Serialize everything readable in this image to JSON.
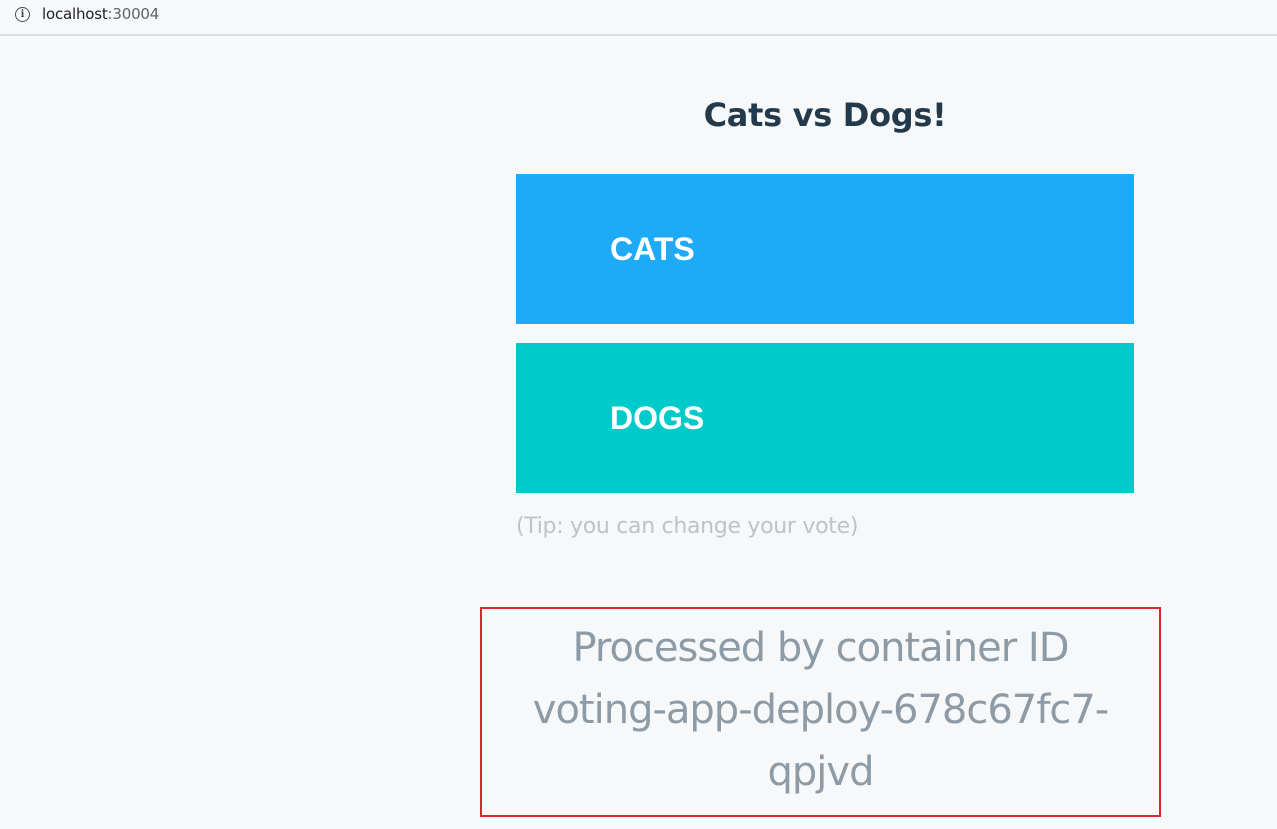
{
  "browser": {
    "url_host": "localhost",
    "url_port": ":30004",
    "info_icon": "info-circle-icon"
  },
  "page": {
    "title": "Cats vs Dogs!",
    "options": [
      {
        "label": "CATS",
        "color": "#1eaaf7"
      },
      {
        "label": "DOGS",
        "color": "#00cbca"
      }
    ],
    "tip": "(Tip: you can change your vote)",
    "processed": {
      "line1": "Processed by container ID",
      "line2": "voting-app-deploy-678c67fc7-",
      "line3": "qpjvd",
      "box_border_color": "#d8262c"
    }
  }
}
